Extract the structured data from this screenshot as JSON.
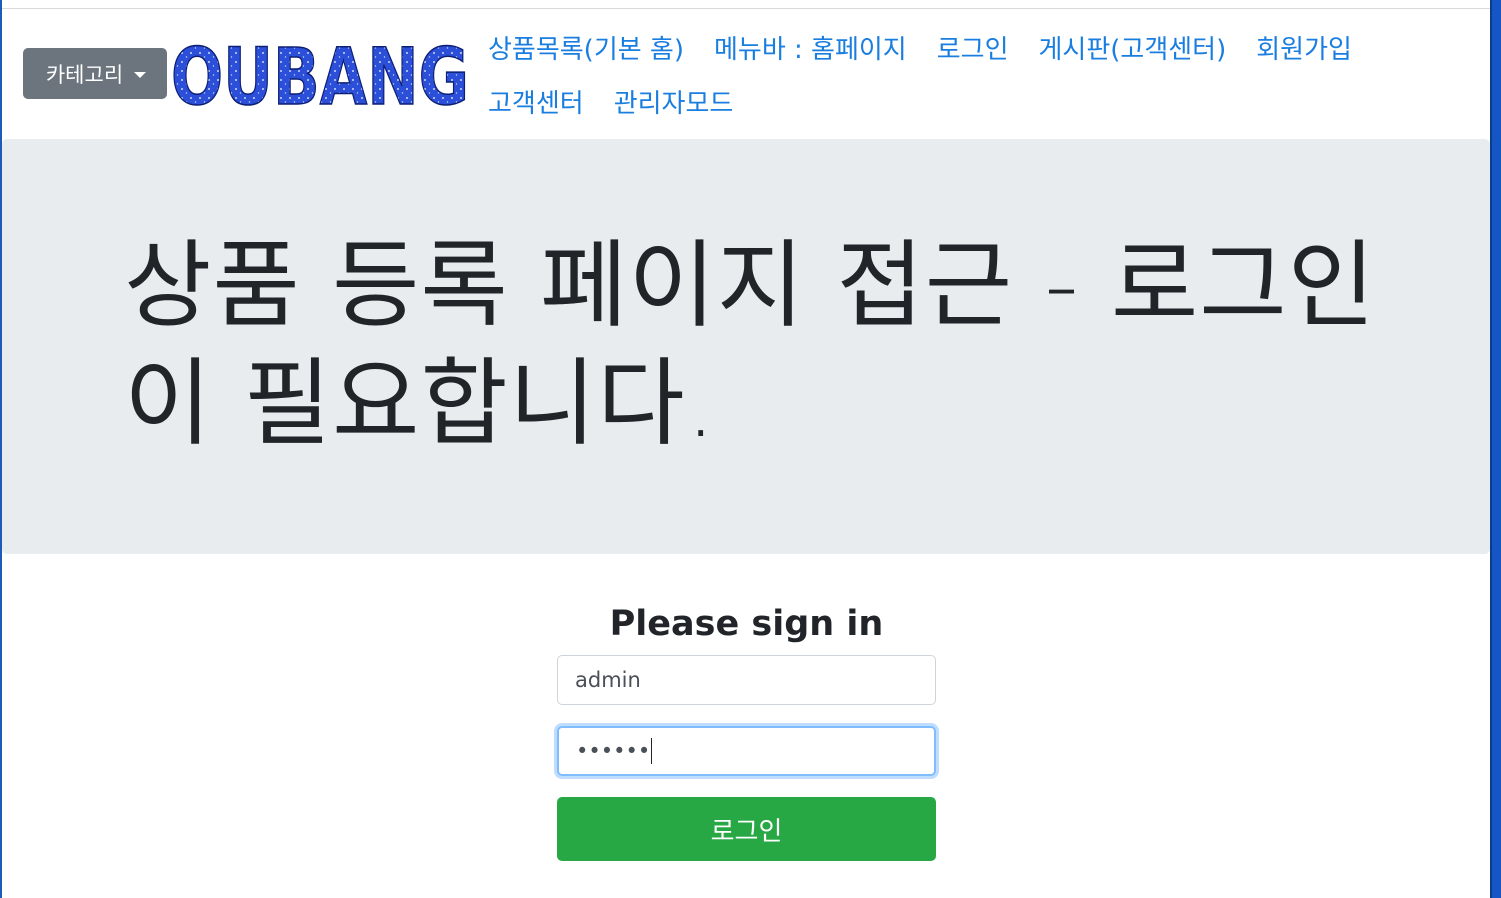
{
  "navbar": {
    "category_label": "카테고리",
    "logo_text": "OUBANG",
    "links_row1": [
      {
        "label": "상품목록(기본 홈)"
      },
      {
        "label": "메뉴바 : 홈페이지"
      },
      {
        "label": "로그인"
      },
      {
        "label": "게시판(고객센터)"
      },
      {
        "label": "회원가입"
      }
    ],
    "links_row2": [
      {
        "label": "고객센터"
      },
      {
        "label": "관리자모드"
      }
    ]
  },
  "jumbotron": {
    "title": "상품 등록 페이지 접근 - 로그인이 필요합니다."
  },
  "signin": {
    "title": "Please sign in",
    "username_value": "admin",
    "password_value": "••••••",
    "submit_label": "로그인"
  },
  "colors": {
    "link": "#1a7ee0",
    "category_button": "#6c757d",
    "jumbotron_bg": "#e9ecef",
    "login_button": "#28a745",
    "logo_fill": "#2b4fd9",
    "window_frame": "#1556c4"
  }
}
